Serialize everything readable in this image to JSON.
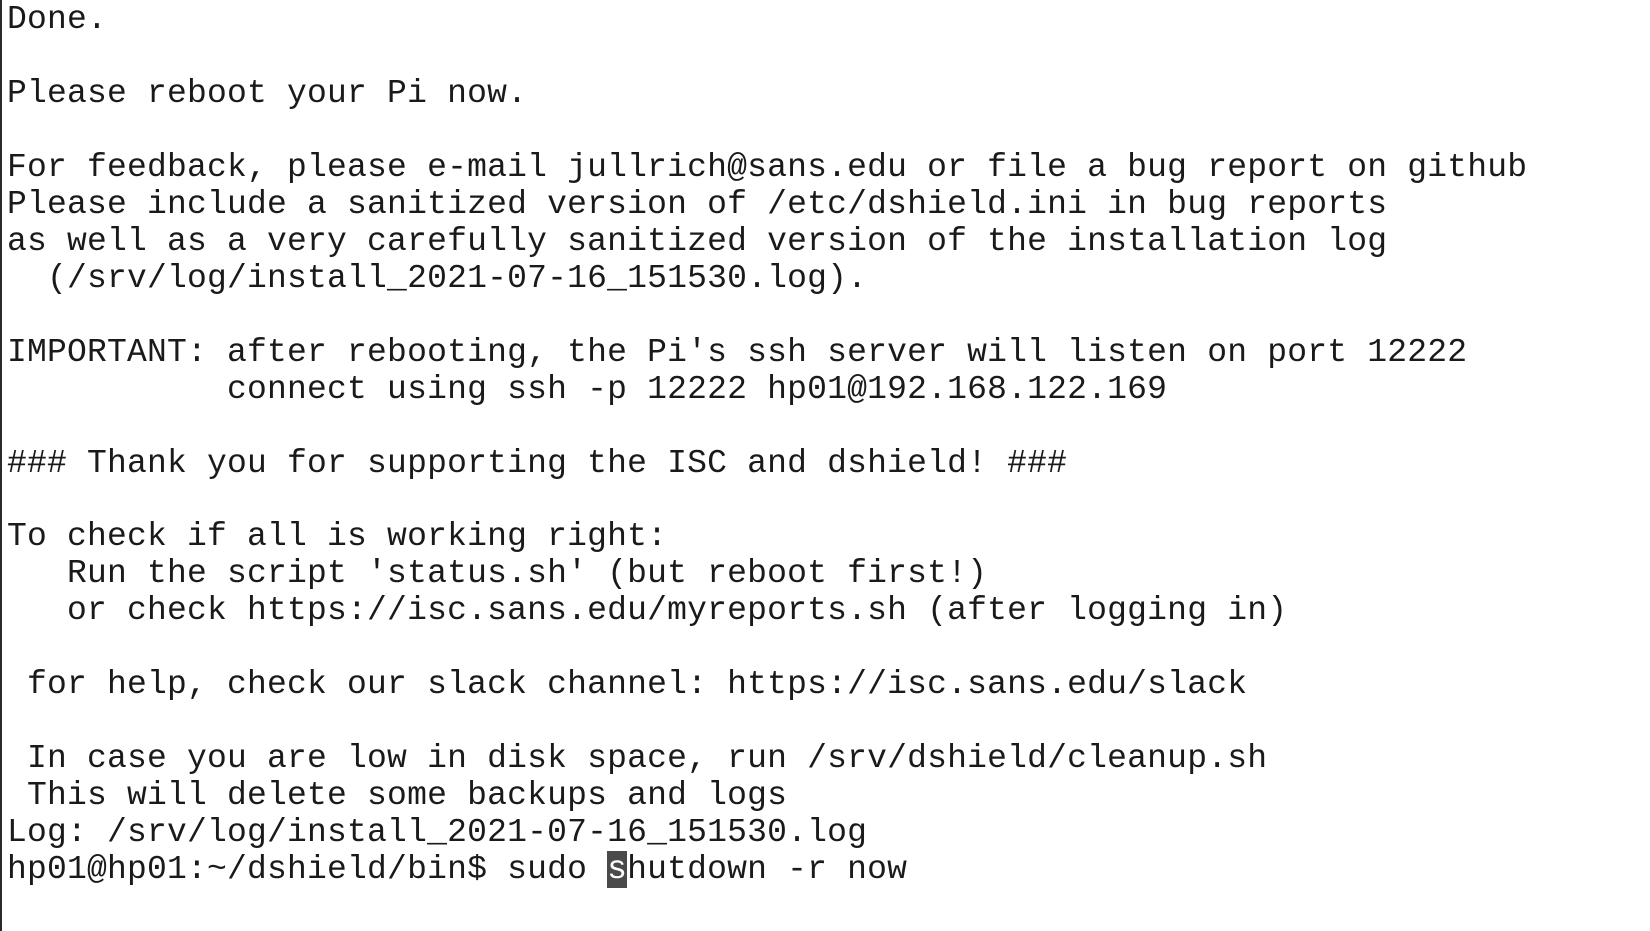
{
  "terminal": {
    "lines": [
      "Done.",
      "",
      "Please reboot your Pi now.",
      "",
      "For feedback, please e-mail jullrich@sans.edu or file a bug report on github",
      "Please include a sanitized version of /etc/dshield.ini in bug reports",
      "as well as a very carefully sanitized version of the installation log",
      "  (/srv/log/install_2021-07-16_151530.log).",
      "",
      "IMPORTANT: after rebooting, the Pi's ssh server will listen on port 12222",
      "           connect using ssh -p 12222 hp01@192.168.122.169",
      "",
      "### Thank you for supporting the ISC and dshield! ###",
      "",
      "To check if all is working right:",
      "   Run the script 'status.sh' (but reboot first!)",
      "   or check https://isc.sans.edu/myreports.sh (after logging in)",
      "",
      " for help, check our slack channel: https://isc.sans.edu/slack",
      "",
      " In case you are low in disk space, run /srv/dshield/cleanup.sh",
      " This will delete some backups and logs",
      "Log: /srv/log/install_2021-07-16_151530.log"
    ],
    "prompt": {
      "prefix": "hp01@hp01:~/dshield/bin$ sudo ",
      "cursor_char": "s",
      "suffix": "hutdown -r now"
    }
  }
}
